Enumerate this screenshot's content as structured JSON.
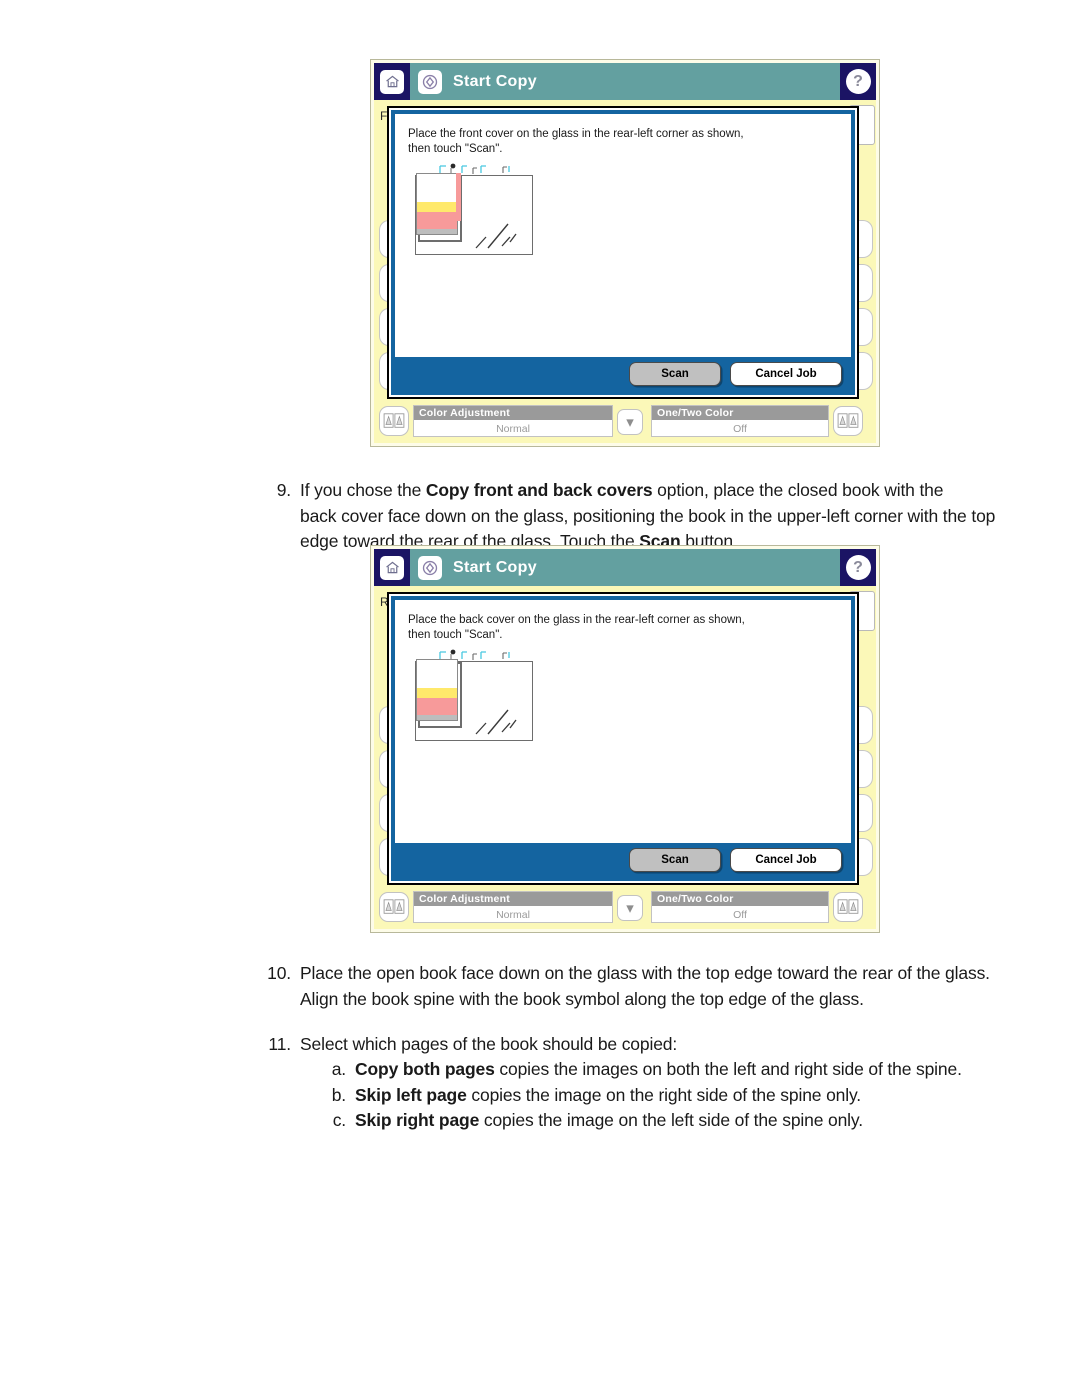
{
  "document": {
    "steps": [
      {
        "number": "9.",
        "lines": [
          [
            {
              "t": "If you chose the ",
              "b": false
            },
            {
              "t": "Copy front and back covers",
              "b": true
            },
            {
              "t": " option, place the closed book with the",
              "b": false
            }
          ],
          [
            {
              "t": "back cover face down on the glass, positioning the book in the upper-left corner with the top",
              "b": false
            }
          ],
          [
            {
              "t": "edge toward the rear of the glass. Touch the ",
              "b": false
            },
            {
              "t": "Scan",
              "b": true
            },
            {
              "t": " button.",
              "b": false
            }
          ]
        ]
      },
      {
        "number": "10.",
        "lines": [
          [
            {
              "t": "Place the open book face down on the glass with the top edge toward the rear of the glass.",
              "b": false
            }
          ],
          [
            {
              "t": "Align the book spine with the book symbol along the top edge of the glass.",
              "b": false
            }
          ]
        ]
      },
      {
        "number": "11.",
        "lines": [
          [
            {
              "t": "Select which pages of the book should be copied:",
              "b": false
            }
          ]
        ]
      }
    ],
    "sub_items": [
      {
        "letter": "a.",
        "parts": [
          {
            "t": "Copy both pages",
            "b": true
          },
          {
            "t": " copies the images on both the left and right side of the spine.",
            "b": false
          }
        ]
      },
      {
        "letter": "b.",
        "parts": [
          {
            "t": "Skip left page",
            "b": true
          },
          {
            "t": " copies the image on the right side of the spine only.",
            "b": false
          }
        ]
      },
      {
        "letter": "c.",
        "parts": [
          {
            "t": "Skip right page",
            "b": true
          },
          {
            "t": " copies the image on the left side of the spine only.",
            "b": false
          }
        ]
      }
    ]
  },
  "colors": {
    "header_navy": "#1b1464",
    "header_teal": "#63a0a0",
    "dialog_blue": "#1464a0",
    "panel_yellow": "#fbf8b8",
    "option_label_gray": "#9a9a9a",
    "book_yellow": "#ffe96b",
    "book_pink": "#f79a9a"
  },
  "panel_front": {
    "header": {
      "home_icon": "home-icon",
      "app_icon": "start-copy-icon",
      "title": "Start Copy",
      "help_icon": "help-icon",
      "help_glyph": "?"
    },
    "background_label": "F",
    "dialog": {
      "message": "Place the front cover on the glass in the rear-left corner as shown, then touch \"Scan\".",
      "illustration_name": "scanner-glass-front-cover-illustration",
      "buttons": {
        "scan": "Scan",
        "cancel": "Cancel Job"
      }
    },
    "options": [
      {
        "icon": "color-adjustment-icon",
        "title": "Color Adjustment",
        "value": "Normal"
      },
      {
        "icon": "one-two-color-icon",
        "title": "One/Two Color",
        "value": "Off"
      }
    ],
    "scroll_chevron": "chevron-down-icon"
  },
  "panel_back": {
    "header": {
      "home_icon": "home-icon",
      "app_icon": "start-copy-icon",
      "title": "Start Copy",
      "help_icon": "help-icon",
      "help_glyph": "?"
    },
    "background_label": "R",
    "dialog": {
      "message": "Place the back cover on the glass in the rear-left corner as shown, then touch \"Scan\".",
      "illustration_name": "scanner-glass-back-cover-illustration",
      "buttons": {
        "scan": "Scan",
        "cancel": "Cancel Job"
      }
    },
    "options": [
      {
        "icon": "color-adjustment-icon",
        "title": "Color Adjustment",
        "value": "Normal"
      },
      {
        "icon": "one-two-color-icon",
        "title": "One/Two Color",
        "value": "Off"
      }
    ],
    "scroll_chevron": "chevron-down-icon"
  }
}
